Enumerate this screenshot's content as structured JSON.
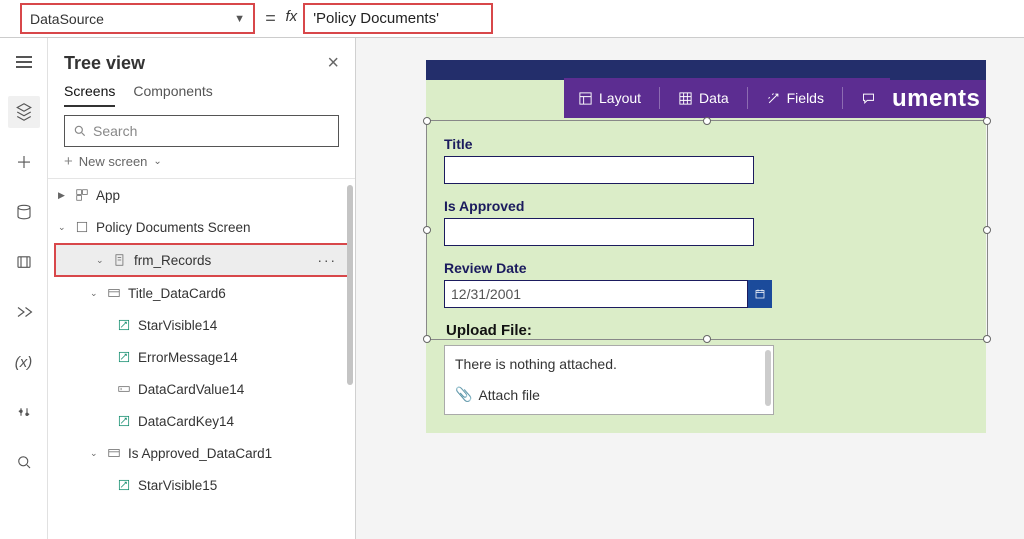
{
  "formula_bar": {
    "property": "DataSource",
    "eq": "=",
    "fx": "fx",
    "value": "'Policy Documents'"
  },
  "tree_panel": {
    "title": "Tree view",
    "tabs": {
      "screens": "Screens",
      "components": "Components"
    },
    "search_placeholder": "Search",
    "new_screen": "New screen",
    "items": {
      "app": "App",
      "screen": "Policy Documents Screen",
      "form": "frm_Records",
      "title_dc": "Title_DataCard6",
      "sv14": "StarVisible14",
      "em14": "ErrorMessage14",
      "dcv14": "DataCardValue14",
      "dck14": "DataCardKey14",
      "approved_dc": "Is Approved_DataCard1",
      "sv15": "StarVisible15"
    }
  },
  "prop_toolbar": {
    "layout": "Layout",
    "data": "Data",
    "fields": "Fields"
  },
  "header_label": "uments",
  "form": {
    "title_label": "Title",
    "approved_label": "Is Approved",
    "review_label": "Review Date",
    "review_value": "12/31/2001",
    "upload_label": "Upload File:",
    "upload_empty": "There is nothing attached.",
    "attach": "Attach file"
  }
}
